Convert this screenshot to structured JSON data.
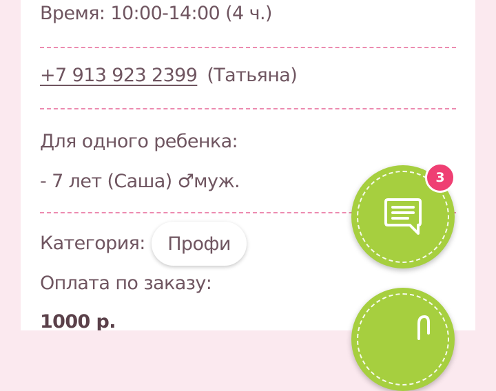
{
  "order": {
    "time": "Время: 10:00-14:00 (4 ч.)",
    "phone": "+7 913 923 2399",
    "contact_name": "(Татьяна)",
    "children_header": "Для одного ребенка:",
    "child_line": "- 7 лет (Саша) ♂муж.",
    "category_label": "Категория:",
    "category_value": "Профи",
    "payment_label": "Оплата по заказу:",
    "payment_amount": "1000 р."
  },
  "chat_fab": {
    "icon": "chat-bubble-icon",
    "badge_count": "3"
  },
  "second_fab": {
    "icon": "pin-icon"
  },
  "colors": {
    "background": "#fbe9ef",
    "text": "#6f5560",
    "separator": "#ec8bb0",
    "fab": "#a6cf3f",
    "badge": "#ef3f73"
  }
}
